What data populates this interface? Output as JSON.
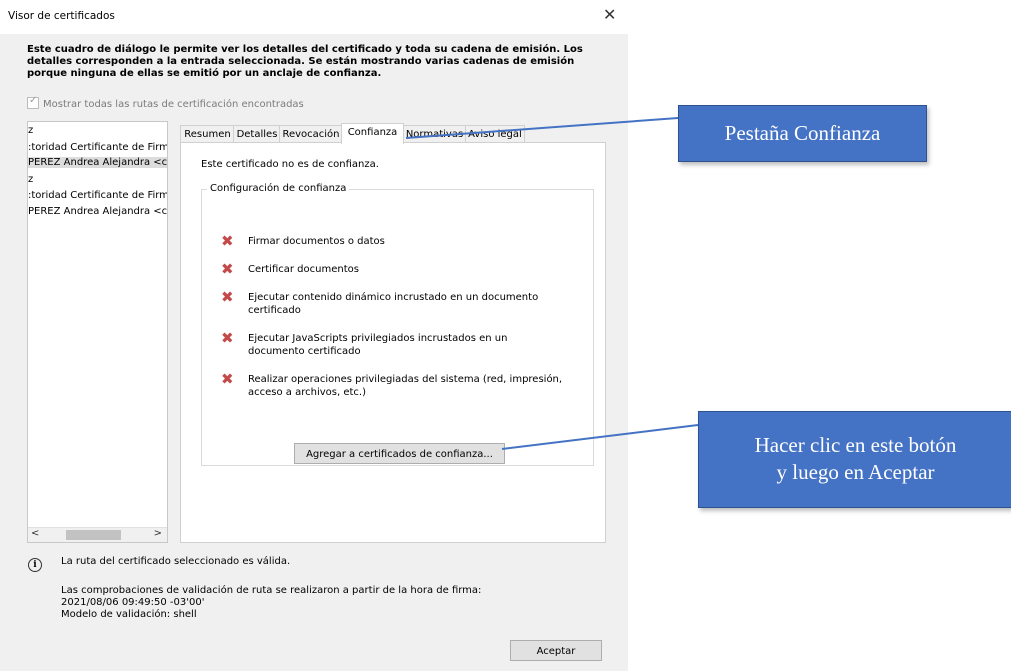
{
  "window": {
    "title": "Visor de certificados",
    "close_glyph": "✕",
    "intro_text": "Este cuadro de diálogo le permite ver los detalles del certificado y toda su cadena de emisión. Los detalles corresponden a la entrada seleccionada. Se están mostrando varias cadenas de emisión porque ninguna de ellas se emitió por un anclaje de confianza.",
    "show_all_label": "Mostrar todas las rutas de certificación encontradas",
    "show_all_checked": true
  },
  "tree": {
    "items": [
      {
        "label": "z"
      },
      {
        "label": ":toridad Certificante de Firma D"
      },
      {
        "label": "PEREZ Andrea Alejandra <cu..."
      },
      {
        "label": "z"
      },
      {
        "label": ":toridad Certificante de Firma D"
      },
      {
        "label": "PEREZ Andrea Alejandra <cu..."
      }
    ],
    "scroll_left": "<",
    "scroll_right": ">"
  },
  "tabs": [
    {
      "label": "Resumen"
    },
    {
      "label": "Detalles"
    },
    {
      "label": "Revocación"
    },
    {
      "label": "Confianza"
    },
    {
      "label": "Normativas"
    },
    {
      "label": "Aviso legal"
    }
  ],
  "trust": {
    "status": "Este certificado no es de confianza.",
    "group_title": "Configuración de confianza",
    "denied_icon": "✖",
    "permissions": [
      {
        "text": "Firmar documentos o datos"
      },
      {
        "text": "Certificar documentos"
      },
      {
        "text": "Ejecutar contenido dinámico incrustado en un documento certificado"
      },
      {
        "text": "Ejecutar JavaScripts privilegiados incrustados en un documento certificado"
      },
      {
        "text": "Realizar operaciones privilegiadas del sistema (red, impresión, acceso a archivos, etc.)"
      }
    ],
    "add_button": "Agregar a certificados de confianza..."
  },
  "footer": {
    "info_icon": "i",
    "valid_msg": "La ruta del certificado seleccionado es válida.",
    "check_line": "Las comprobaciones de validación de ruta se realizaron a partir de la hora de firma:",
    "check_time": "2021/08/06 09:49:50 -03'00'",
    "model_line": "Modelo de validación: shell",
    "ok_button": "Aceptar"
  },
  "callouts": {
    "tab": {
      "text": "Pestaña Confianza"
    },
    "button": {
      "line1": "Hacer clic en este botón",
      "line2": "y luego en Aceptar"
    }
  },
  "colors": {
    "callout_fill": "#4472c4",
    "callout_border": "#2f528f",
    "denied": "#c44a4a"
  }
}
